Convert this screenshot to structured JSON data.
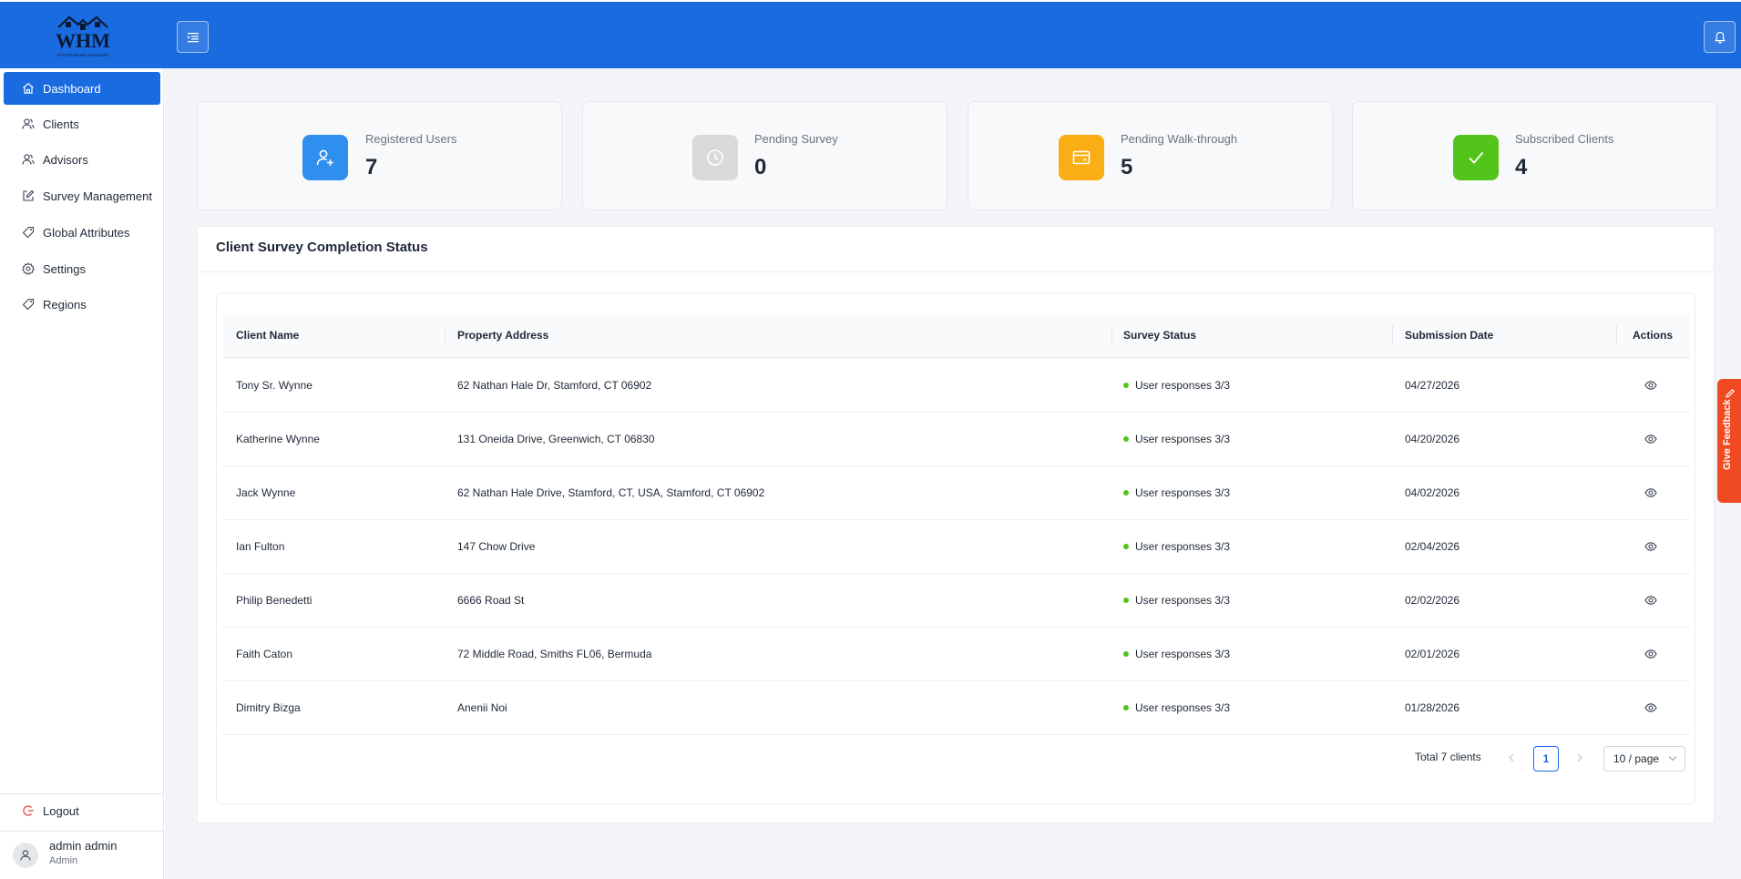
{
  "brand": {
    "logo_text": "WHM",
    "logo_subtitle": "WYNNE HOME MANAGER",
    "primary_color": "#1a6ae0"
  },
  "topbar": {
    "menu_toggle_icon": "menu-fold-icon",
    "notification_icon": "bell-icon"
  },
  "sidebar": {
    "items": [
      {
        "label": "Dashboard",
        "icon": "home-icon",
        "active": true
      },
      {
        "label": "Clients",
        "icon": "users-icon",
        "active": false
      },
      {
        "label": "Advisors",
        "icon": "users-icon",
        "active": false
      },
      {
        "label": "Survey Management",
        "icon": "edit-icon",
        "active": false
      },
      {
        "label": "Global Attributes",
        "icon": "tag-icon",
        "active": false
      },
      {
        "label": "Settings",
        "icon": "gear-icon",
        "active": false
      },
      {
        "label": "Regions",
        "icon": "tag-icon",
        "active": false
      }
    ],
    "logout_label": "Logout",
    "user": {
      "name": "admin admin",
      "role": "Admin"
    }
  },
  "stats": [
    {
      "label": "Registered Users",
      "value": "7",
      "icon": "user-add-icon",
      "color": "#2f8fee"
    },
    {
      "label": "Pending Survey",
      "value": "0",
      "icon": "clock-icon",
      "color": "#d9d9d9"
    },
    {
      "label": "Pending Walk-through",
      "value": "5",
      "icon": "credit-card-icon",
      "color": "#faad14"
    },
    {
      "label": "Subscribed Clients",
      "value": "4",
      "icon": "check-icon",
      "color": "#52c41a"
    }
  ],
  "survey_panel": {
    "title": "Client Survey Completion Status",
    "columns": [
      "Client Name",
      "Property Address",
      "Survey Status",
      "Submission Date",
      "Actions"
    ],
    "rows": [
      {
        "client": "Tony Sr. Wynne",
        "address": "62 Nathan Hale Dr, Stamford, CT 06902",
        "status": "User responses 3/3",
        "date": "04/27/2026"
      },
      {
        "client": "Katherine Wynne",
        "address": "131 Oneida Drive, Greenwich, CT 06830",
        "status": "User responses 3/3",
        "date": "04/20/2026"
      },
      {
        "client": "Jack Wynne",
        "address": "62 Nathan Hale Drive, Stamford, CT, USA, Stamford, CT 06902",
        "status": "User responses 3/3",
        "date": "04/02/2026"
      },
      {
        "client": "Ian Fulton",
        "address": "147 Chow Drive",
        "status": "User responses 3/3",
        "date": "02/04/2026"
      },
      {
        "client": "Philip Benedetti",
        "address": "6666 Road St",
        "status": "User responses 3/3",
        "date": "02/02/2026"
      },
      {
        "client": "Faith Caton",
        "address": "72 Middle Road, Smiths FL06, Bermuda",
        "status": "User responses 3/3",
        "date": "02/01/2026"
      },
      {
        "client": "Dimitry Bizga",
        "address": "Anenii Noi",
        "status": "User responses 3/3",
        "date": "01/28/2026"
      }
    ],
    "status_color": "#52c41a",
    "pagination": {
      "total_label": "Total 7 clients",
      "current_page": "1",
      "page_size": "10 / page"
    }
  },
  "feedback": {
    "label": "Give Feedback",
    "color": "#f04a23"
  }
}
